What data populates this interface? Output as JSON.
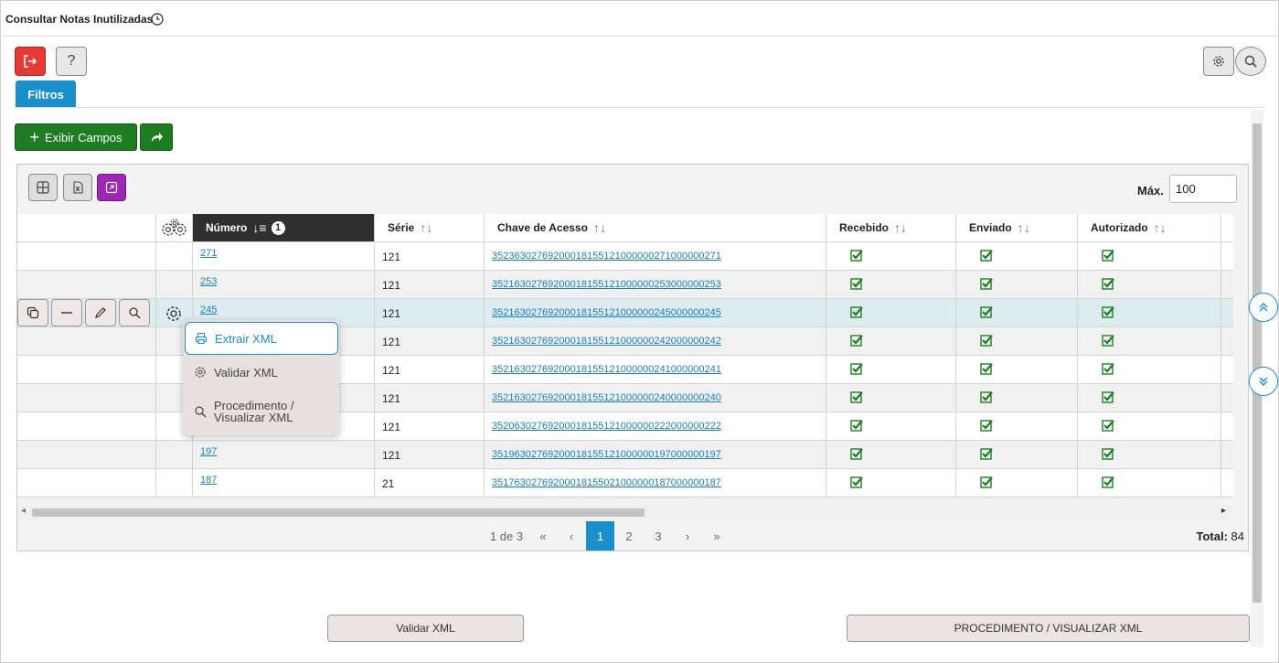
{
  "page": {
    "title": "Consultar Notas Inutilizadas",
    "filters_tab": "Filtros"
  },
  "toolbar": {
    "show_fields_label": "Exibir Campos",
    "max_label": "Máx.",
    "max_value": "100"
  },
  "table": {
    "columns": [
      "Número",
      "Série",
      "Chave de Acesso",
      "Recebido",
      "Enviado",
      "Autorizado"
    ],
    "sort_badge": "1",
    "rows": [
      {
        "numero": "271",
        "serie": "121",
        "chave": "35236302769200018155121000000271000000271",
        "recebido": true,
        "enviado": true,
        "autorizado": true
      },
      {
        "numero": "253",
        "serie": "121",
        "chave": "35216302769200018155121000000253000000253",
        "recebido": true,
        "enviado": true,
        "autorizado": true
      },
      {
        "numero": "245",
        "serie": "121",
        "chave": "35216302769200018155121000000245000000245",
        "recebido": true,
        "enviado": true,
        "autorizado": true
      },
      {
        "numero": "",
        "serie": "121",
        "chave": "35216302769200018155121000000242000000242",
        "recebido": true,
        "enviado": true,
        "autorizado": true
      },
      {
        "numero": "",
        "serie": "121",
        "chave": "35216302769200018155121000000241000000241",
        "recebido": true,
        "enviado": true,
        "autorizado": true
      },
      {
        "numero": "",
        "serie": "121",
        "chave": "35216302769200018155121000000240000000240",
        "recebido": true,
        "enviado": true,
        "autorizado": true
      },
      {
        "numero": "",
        "serie": "121",
        "chave": "35206302769200018155121000000222000000222",
        "recebido": true,
        "enviado": true,
        "autorizado": true
      },
      {
        "numero": "197",
        "serie": "121",
        "chave": "35196302769200018155121000000197000000197",
        "recebido": true,
        "enviado": true,
        "autorizado": true
      },
      {
        "numero": "187",
        "serie": "21",
        "chave": "35176302769200018155021000000187000000187",
        "recebido": true,
        "enviado": true,
        "autorizado": true
      }
    ]
  },
  "context_menu": {
    "items": [
      "Extrair XML",
      "Validar XML",
      "Procedimento / Visualizar XML"
    ]
  },
  "pagination": {
    "info": "1 de 3",
    "first": "«",
    "prev": "‹",
    "pages": [
      "1",
      "2",
      "3"
    ],
    "next": "›",
    "last": "»",
    "total_label": "Total:",
    "total_value": "84"
  },
  "footer": {
    "validate_button": "Validar XML",
    "procedure_button": "PROCEDIMENTO / VISUALIZAR XML"
  },
  "colors": {
    "accent": "#1b8fc9",
    "success": "#1e7d22",
    "danger": "#e53935",
    "purple": "#9c27b0"
  }
}
